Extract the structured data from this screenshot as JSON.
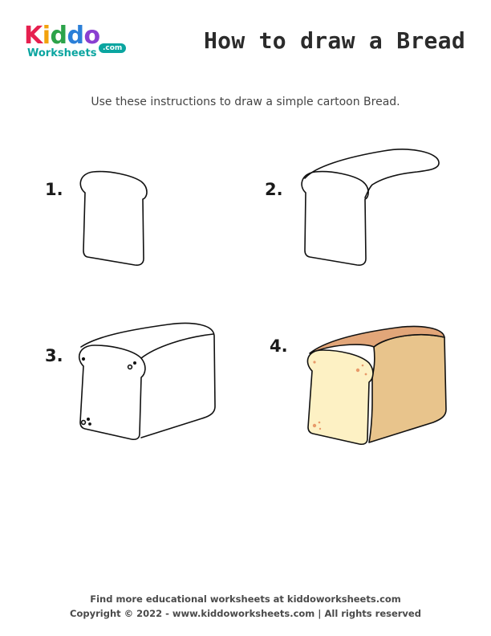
{
  "logo": {
    "letters": [
      "K",
      "i",
      "d",
      "d",
      "o"
    ],
    "letter_colors": [
      "#e6204f",
      "#f2a20d",
      "#2ca34a",
      "#2b7fd8",
      "#8a3fd1"
    ],
    "subtitle": "Worksheets",
    "domain": ".com"
  },
  "title": "How to draw a Bread",
  "instructions": "Use these instructions to draw a simple cartoon Bread.",
  "steps": [
    {
      "number": "1."
    },
    {
      "number": "2."
    },
    {
      "number": "3."
    },
    {
      "number": "4."
    }
  ],
  "colors": {
    "outline": "#111111",
    "crust_top": "#e2a679",
    "crust_side": "#e8c48c",
    "slice_face": "#fdf1c4",
    "speckle": "#e89a6a"
  },
  "footer": {
    "line1": "Find more educational worksheets at kiddoworksheets.com",
    "line2": "Copyright © 2022 - www.kiddoworksheets.com  |  All rights reserved"
  }
}
